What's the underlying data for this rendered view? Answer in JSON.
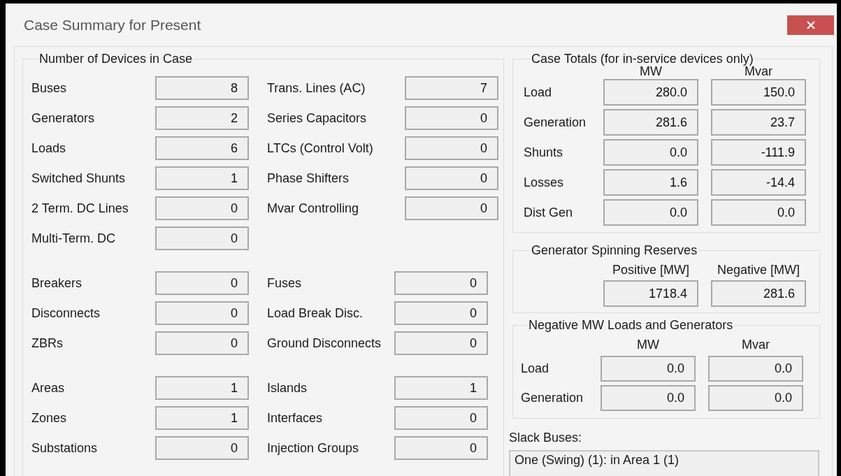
{
  "window": {
    "title": "Case Summary for Present"
  },
  "devices": {
    "title": "Number of Devices in Case",
    "blocks": [
      {
        "rows": [
          {
            "left": {
              "label": "Buses",
              "value": "8"
            },
            "right": {
              "label": "Trans. Lines (AC)",
              "value": "7"
            }
          },
          {
            "left": {
              "label": "Generators",
              "value": "2"
            },
            "right": {
              "label": "Series Capacitors",
              "value": "0"
            }
          },
          {
            "left": {
              "label": "Loads",
              "value": "6"
            },
            "right": {
              "label": "LTCs (Control Volt)",
              "value": "0"
            }
          },
          {
            "left": {
              "label": "Switched Shunts",
              "value": "1"
            },
            "right": {
              "label": "Phase Shifters",
              "value": "0"
            }
          },
          {
            "left": {
              "label": "2 Term. DC Lines",
              "value": "0"
            },
            "right": {
              "label": "Mvar Controlling",
              "value": "0"
            }
          },
          {
            "left": {
              "label": "Multi-Term. DC",
              "value": "0"
            }
          }
        ]
      },
      {
        "rows": [
          {
            "left": {
              "label": "Breakers",
              "value": "0"
            },
            "right": {
              "label": "Fuses",
              "value": "0"
            }
          },
          {
            "left": {
              "label": "Disconnects",
              "value": "0"
            },
            "right": {
              "label": "Load Break Disc.",
              "value": "0"
            }
          },
          {
            "left": {
              "label": "ZBRs",
              "value": "0"
            },
            "right": {
              "label": "Ground Disconnects",
              "value": "0"
            }
          }
        ]
      },
      {
        "rows": [
          {
            "left": {
              "label": "Areas",
              "value": "1"
            },
            "right": {
              "label": "Islands",
              "value": "1"
            }
          },
          {
            "left": {
              "label": "Zones",
              "value": "1"
            },
            "right": {
              "label": "Interfaces",
              "value": "0"
            }
          },
          {
            "left": {
              "label": "Substations",
              "value": "0"
            },
            "right": {
              "label": "Injection Groups",
              "value": "0"
            }
          }
        ]
      }
    ]
  },
  "case_totals": {
    "title": "Case Totals (for in-service devices only)",
    "columns": [
      "MW",
      "Mvar"
    ],
    "rows": [
      {
        "label": "Load",
        "values": [
          "280.0",
          "150.0"
        ]
      },
      {
        "label": "Generation",
        "values": [
          "281.6",
          "23.7"
        ]
      },
      {
        "label": "Shunts",
        "values": [
          "0.0",
          "-111.9"
        ]
      },
      {
        "label": "Losses",
        "values": [
          "1.6",
          "-14.4"
        ]
      },
      {
        "label": "Dist Gen",
        "values": [
          "0.0",
          "0.0"
        ]
      }
    ]
  },
  "spinning_reserves": {
    "title": "Generator Spinning Reserves",
    "columns": [
      "Positive [MW]",
      "Negative [MW]"
    ],
    "rows": [
      {
        "values": [
          "1718.4",
          "281.6"
        ]
      }
    ]
  },
  "negative_loads": {
    "title": "Negative MW Loads and Generators",
    "columns": [
      "MW",
      "Mvar"
    ],
    "rows": [
      {
        "label": "Load",
        "values": [
          "0.0",
          "0.0"
        ]
      },
      {
        "label": "Generation",
        "values": [
          "0.0",
          "0.0"
        ]
      }
    ]
  },
  "slack_buses": {
    "label": "Slack Buses:",
    "items": [
      "One (Swing) (1): in Area 1 (1)"
    ]
  }
}
